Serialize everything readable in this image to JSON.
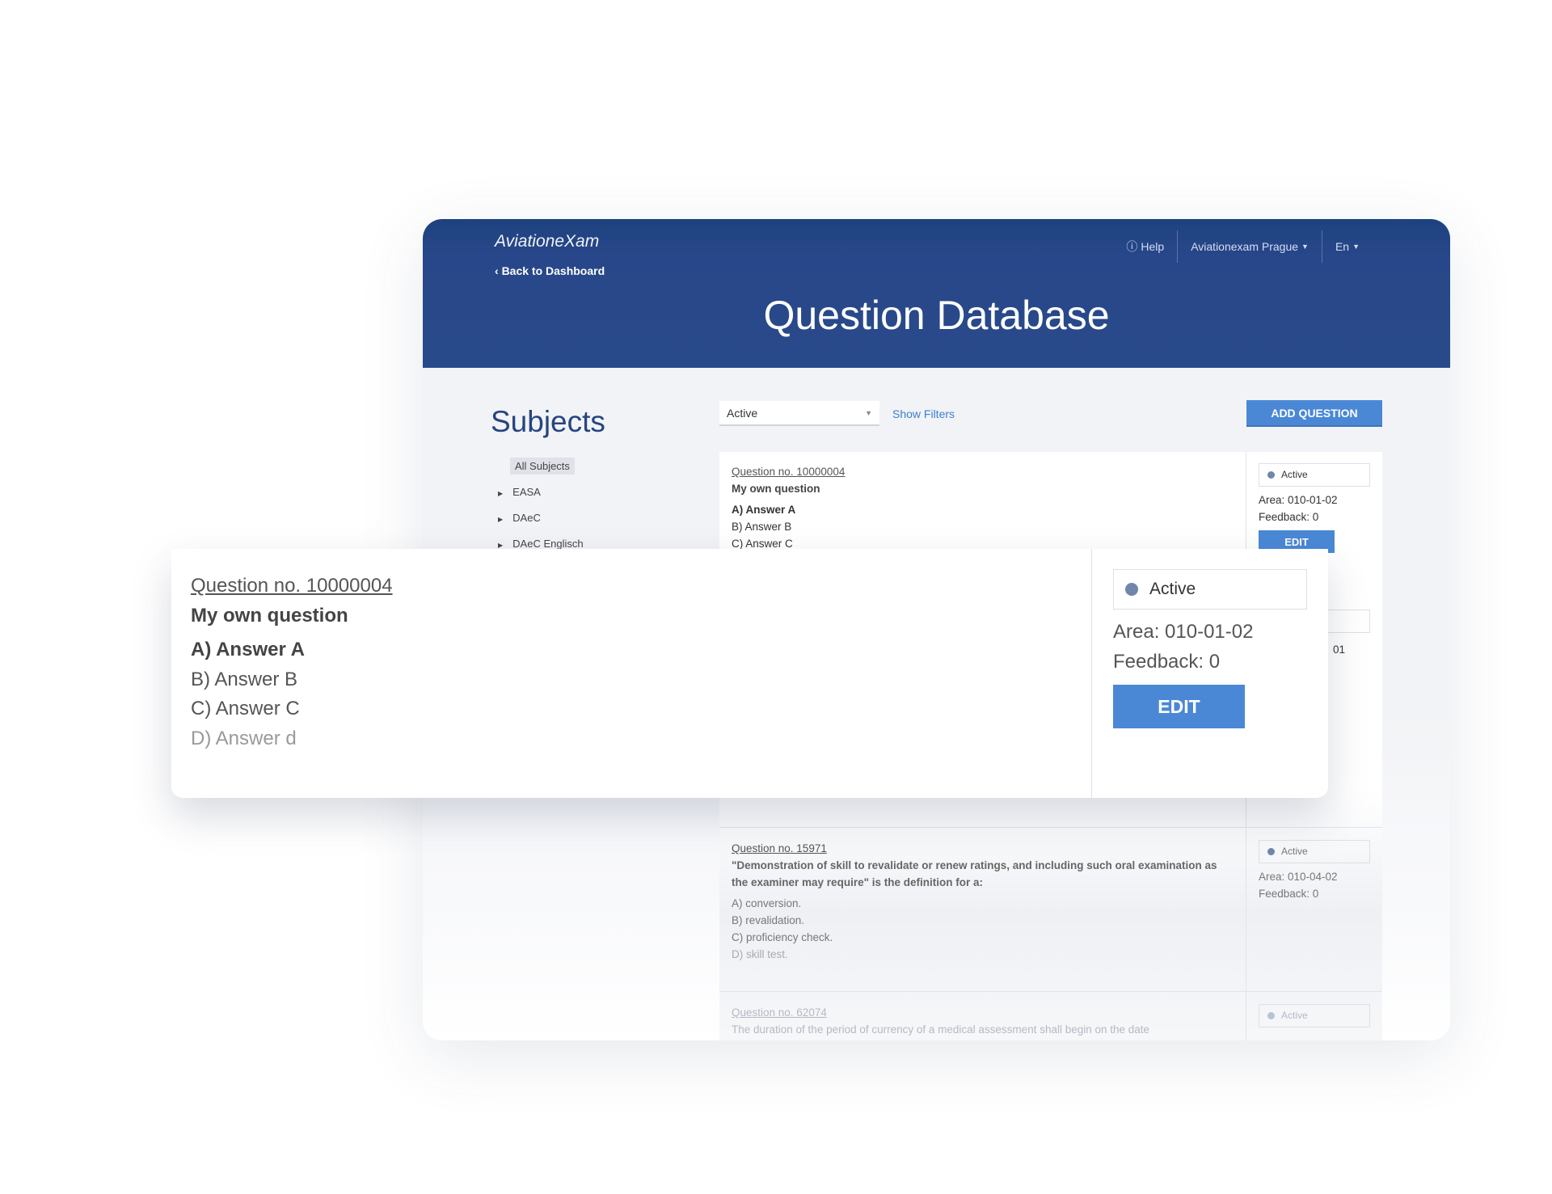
{
  "header": {
    "logo": "AviationeXam",
    "back_label": "Back to Dashboard",
    "title": "Question Database",
    "help_label": "Help",
    "org_label": "Aviationexam Prague",
    "lang_label": "En"
  },
  "sidebar": {
    "title": "Subjects",
    "all_label": "All Subjects",
    "items": [
      "EASA",
      "DAeC",
      "DAeC Englisch"
    ]
  },
  "toolbar": {
    "status_select": "Active",
    "show_filters": "Show Filters",
    "add_question": "ADD QUESTION"
  },
  "questions": [
    {
      "number": "Question no. 10000004",
      "text": "My own question",
      "answers": [
        "A) Answer A",
        "B) Answer B",
        "C) Answer C",
        "D) Answer d"
      ],
      "status": "Active",
      "area": "Area: 010-01-02",
      "feedback": "Feedback: 0",
      "edit": "EDIT"
    },
    {
      "area_partial": "01"
    },
    {
      "number": "Question no. 15971",
      "text": "\"Demonstration of skill to revalidate or renew ratings, and including such oral examination as the examiner may require\" is the definition for a:",
      "answers": [
        "A) conversion.",
        "B) revalidation.",
        "C) proficiency check.",
        "D) skill test."
      ],
      "status": "Active",
      "area": "Area: 010-04-02",
      "feedback": "Feedback: 0"
    },
    {
      "number": "Question no. 62074",
      "text": "The duration of the period of currency of a medical assessment shall begin on the date",
      "status": "Active"
    }
  ],
  "colors": {
    "header": "#294a8a",
    "accent": "#4a88d6"
  }
}
